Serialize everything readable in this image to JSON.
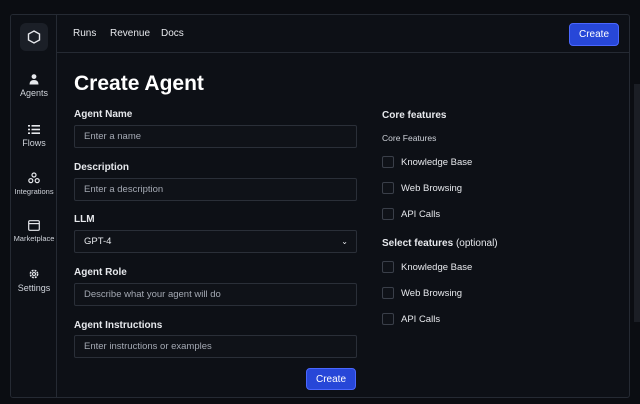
{
  "nav": {
    "items": [
      {
        "label": "Agents",
        "icon": "user-icon"
      },
      {
        "label": "Flows",
        "icon": "list-icon"
      },
      {
        "label": "Integrations",
        "icon": "nodes-icon"
      },
      {
        "label": "Marketplace",
        "icon": "browser-icon"
      },
      {
        "label": "Settings",
        "icon": "gear-icon"
      }
    ]
  },
  "topbar": {
    "links": [
      "Runs",
      "Revenue",
      "Docs"
    ],
    "create_label": "Create"
  },
  "page": {
    "title": "Create Agent"
  },
  "form": {
    "agent_name": {
      "label": "Agent Name",
      "placeholder": "Enter a name"
    },
    "description": {
      "label": "Description",
      "placeholder": "Enter a description"
    },
    "llm": {
      "label": "LLM",
      "value": "GPT-4"
    },
    "agent_role": {
      "label": "Agent Role",
      "placeholder": "Describe what your agent will do"
    },
    "agent_instructions": {
      "label": "Agent Instructions",
      "placeholder": "Enter instructions or examples"
    },
    "submit_label": "Create"
  },
  "core_features": {
    "title": "Core features",
    "subtitle": "Core Features",
    "items": [
      "Knowledge Base",
      "Web Browsing",
      "API Calls"
    ]
  },
  "select_features": {
    "title": "Select features",
    "optional": "(optional)",
    "items": [
      "Knowledge Base",
      "Web Browsing",
      "API Calls"
    ]
  },
  "colors": {
    "accent": "#2747d8",
    "background": "#0d1016",
    "border": "#252a33"
  }
}
